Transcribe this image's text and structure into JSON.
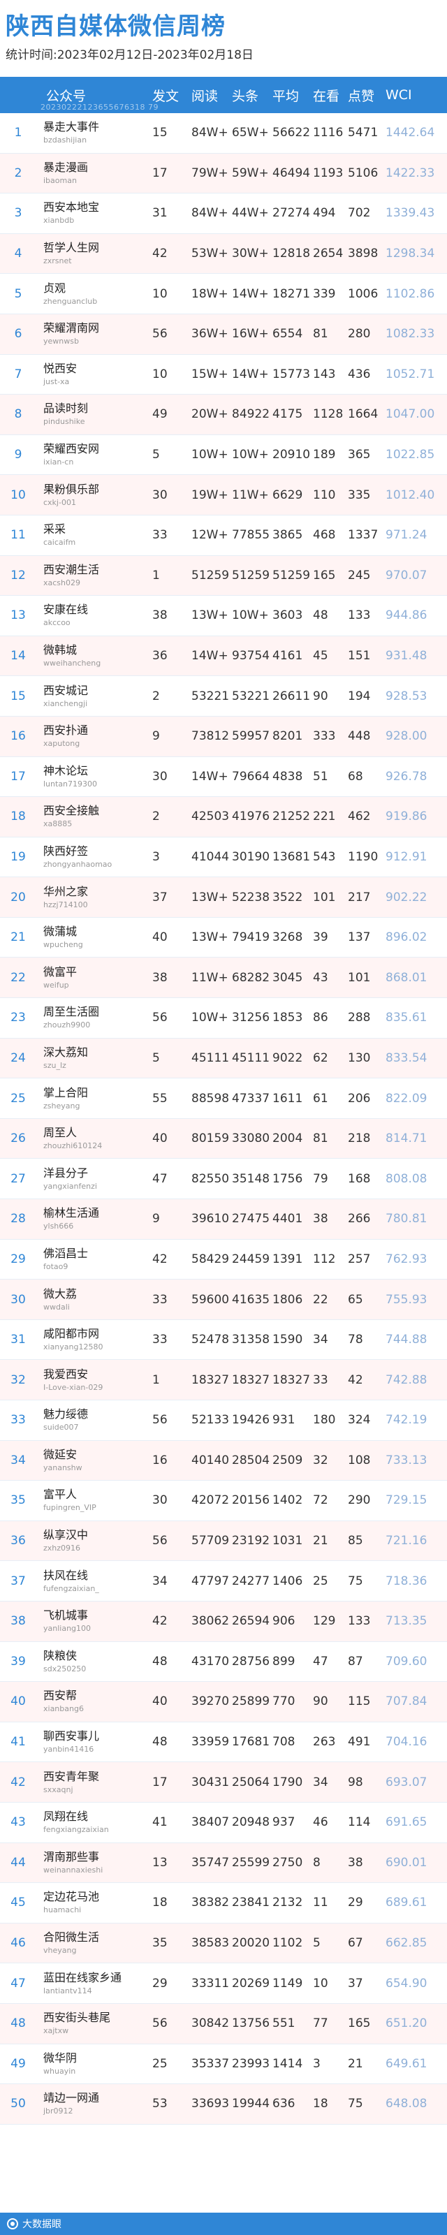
{
  "header": {
    "title": "陕西自媒体微信周榜",
    "subtitle": "统计时间:2023年02月12日-2023年02月18日"
  },
  "table": {
    "columns": {
      "account": "公众号",
      "posts": "发文",
      "reads": "阅读",
      "headline": "头条",
      "avg": "平均",
      "watching": "在看",
      "likes": "点赞",
      "wci": "WCI"
    },
    "watermark": "20230222123655676318 79",
    "rows": [
      {
        "rank": "1",
        "name": "暴走大事件",
        "id": "bzdashijian",
        "posts": "15",
        "reads": "84W+",
        "headline": "65W+",
        "avg": "56622",
        "watching": "1116",
        "likes": "5471",
        "wci": "1442.64"
      },
      {
        "rank": "2",
        "name": "暴走漫画",
        "id": "ibaoman",
        "posts": "17",
        "reads": "79W+",
        "headline": "59W+",
        "avg": "46494",
        "watching": "1193",
        "likes": "5106",
        "wci": "1422.33"
      },
      {
        "rank": "3",
        "name": "西安本地宝",
        "id": "xianbdb",
        "posts": "31",
        "reads": "84W+",
        "headline": "44W+",
        "avg": "27274",
        "watching": "494",
        "likes": "702",
        "wci": "1339.43"
      },
      {
        "rank": "4",
        "name": "哲学人生网",
        "id": "zxrsnet",
        "posts": "42",
        "reads": "53W+",
        "headline": "30W+",
        "avg": "12818",
        "watching": "2654",
        "likes": "3898",
        "wci": "1298.34"
      },
      {
        "rank": "5",
        "name": "贞观",
        "id": "zhenguanclub",
        "posts": "10",
        "reads": "18W+",
        "headline": "14W+",
        "avg": "18271",
        "watching": "339",
        "likes": "1006",
        "wci": "1102.86"
      },
      {
        "rank": "6",
        "name": "荣耀渭南网",
        "id": "yewnwsb",
        "posts": "56",
        "reads": "36W+",
        "headline": "16W+",
        "avg": "6554",
        "watching": "81",
        "likes": "280",
        "wci": "1082.33"
      },
      {
        "rank": "7",
        "name": "悦西安",
        "id": "just-xa",
        "posts": "10",
        "reads": "15W+",
        "headline": "14W+",
        "avg": "15773",
        "watching": "143",
        "likes": "436",
        "wci": "1052.71"
      },
      {
        "rank": "8",
        "name": "品读时刻",
        "id": "pindushike",
        "posts": "49",
        "reads": "20W+",
        "headline": "84922",
        "avg": "4175",
        "watching": "1128",
        "likes": "1664",
        "wci": "1047.00"
      },
      {
        "rank": "9",
        "name": "荣耀西安网",
        "id": "ixian-cn",
        "posts": "5",
        "reads": "10W+",
        "headline": "10W+",
        "avg": "20910",
        "watching": "189",
        "likes": "365",
        "wci": "1022.85"
      },
      {
        "rank": "10",
        "name": "果粉俱乐部",
        "id": "cxkj-001",
        "posts": "30",
        "reads": "19W+",
        "headline": "11W+",
        "avg": "6629",
        "watching": "110",
        "likes": "335",
        "wci": "1012.40"
      },
      {
        "rank": "11",
        "name": "采采",
        "id": "caicaifm",
        "posts": "33",
        "reads": "12W+",
        "headline": "77855",
        "avg": "3865",
        "watching": "468",
        "likes": "1337",
        "wci": "971.24"
      },
      {
        "rank": "12",
        "name": "西安潮生活",
        "id": "xacsh029",
        "posts": "1",
        "reads": "51259",
        "headline": "51259",
        "avg": "51259",
        "watching": "165",
        "likes": "245",
        "wci": "970.07"
      },
      {
        "rank": "13",
        "name": "安康在线",
        "id": "akccoo",
        "posts": "38",
        "reads": "13W+",
        "headline": "10W+",
        "avg": "3603",
        "watching": "48",
        "likes": "133",
        "wci": "944.86"
      },
      {
        "rank": "14",
        "name": "微韩城",
        "id": "wweihancheng",
        "posts": "36",
        "reads": "14W+",
        "headline": "93754",
        "avg": "4161",
        "watching": "45",
        "likes": "151",
        "wci": "931.48"
      },
      {
        "rank": "15",
        "name": "西安城记",
        "id": "xianchengji",
        "posts": "2",
        "reads": "53221",
        "headline": "53221",
        "avg": "26611",
        "watching": "90",
        "likes": "194",
        "wci": "928.53"
      },
      {
        "rank": "16",
        "name": "西安扑通",
        "id": "xaputong",
        "posts": "9",
        "reads": "73812",
        "headline": "59957",
        "avg": "8201",
        "watching": "333",
        "likes": "448",
        "wci": "928.00"
      },
      {
        "rank": "17",
        "name": "神木论坛",
        "id": "luntan719300",
        "posts": "30",
        "reads": "14W+",
        "headline": "79664",
        "avg": "4838",
        "watching": "51",
        "likes": "68",
        "wci": "926.78"
      },
      {
        "rank": "18",
        "name": "西安全接触",
        "id": "xa8885",
        "posts": "2",
        "reads": "42503",
        "headline": "41976",
        "avg": "21252",
        "watching": "221",
        "likes": "462",
        "wci": "919.86"
      },
      {
        "rank": "19",
        "name": "陕西好签",
        "id": "zhongyanhaomao",
        "posts": "3",
        "reads": "41044",
        "headline": "30190",
        "avg": "13681",
        "watching": "543",
        "likes": "1190",
        "wci": "912.91"
      },
      {
        "rank": "20",
        "name": "华州之家",
        "id": "hzzj714100",
        "posts": "37",
        "reads": "13W+",
        "headline": "52238",
        "avg": "3522",
        "watching": "101",
        "likes": "217",
        "wci": "902.22"
      },
      {
        "rank": "21",
        "name": "微蒲城",
        "id": "wpucheng",
        "posts": "40",
        "reads": "13W+",
        "headline": "79419",
        "avg": "3268",
        "watching": "39",
        "likes": "137",
        "wci": "896.02"
      },
      {
        "rank": "22",
        "name": "微富平",
        "id": "weifup",
        "posts": "38",
        "reads": "11W+",
        "headline": "68282",
        "avg": "3045",
        "watching": "43",
        "likes": "101",
        "wci": "868.01"
      },
      {
        "rank": "23",
        "name": "周至生活圈",
        "id": "zhouzh9900",
        "posts": "56",
        "reads": "10W+",
        "headline": "31256",
        "avg": "1853",
        "watching": "86",
        "likes": "288",
        "wci": "835.61"
      },
      {
        "rank": "24",
        "name": "深大荔知",
        "id": "szu_lz",
        "posts": "5",
        "reads": "45111",
        "headline": "45111",
        "avg": "9022",
        "watching": "62",
        "likes": "130",
        "wci": "833.54"
      },
      {
        "rank": "25",
        "name": "掌上合阳",
        "id": "zsheyang",
        "posts": "55",
        "reads": "88598",
        "headline": "47337",
        "avg": "1611",
        "watching": "61",
        "likes": "206",
        "wci": "822.09"
      },
      {
        "rank": "26",
        "name": "周至人",
        "id": "zhouzhi610124",
        "posts": "40",
        "reads": "80159",
        "headline": "33080",
        "avg": "2004",
        "watching": "81",
        "likes": "218",
        "wci": "814.71"
      },
      {
        "rank": "27",
        "name": "洋县分子",
        "id": "yangxianfenzi",
        "posts": "47",
        "reads": "82550",
        "headline": "35148",
        "avg": "1756",
        "watching": "79",
        "likes": "168",
        "wci": "808.08"
      },
      {
        "rank": "28",
        "name": "榆林生活通",
        "id": "ylsh666",
        "posts": "9",
        "reads": "39610",
        "headline": "27475",
        "avg": "4401",
        "watching": "38",
        "likes": "266",
        "wci": "780.81"
      },
      {
        "rank": "29",
        "name": "佛滔昌士",
        "id": "fotao9",
        "posts": "42",
        "reads": "58429",
        "headline": "24459",
        "avg": "1391",
        "watching": "112",
        "likes": "257",
        "wci": "762.93"
      },
      {
        "rank": "30",
        "name": "微大荔",
        "id": "wwdali",
        "posts": "33",
        "reads": "59600",
        "headline": "41635",
        "avg": "1806",
        "watching": "22",
        "likes": "65",
        "wci": "755.93"
      },
      {
        "rank": "31",
        "name": "咸阳都市网",
        "id": "xianyang12580",
        "posts": "33",
        "reads": "52478",
        "headline": "31358",
        "avg": "1590",
        "watching": "34",
        "likes": "78",
        "wci": "744.88"
      },
      {
        "rank": "32",
        "name": "我爱西安",
        "id": "I-Love-xian-029",
        "posts": "1",
        "reads": "18327",
        "headline": "18327",
        "avg": "18327",
        "watching": "33",
        "likes": "42",
        "wci": "742.88"
      },
      {
        "rank": "33",
        "name": "魅力绥德",
        "id": "suide007",
        "posts": "56",
        "reads": "52133",
        "headline": "19426",
        "avg": "931",
        "watching": "180",
        "likes": "324",
        "wci": "742.19"
      },
      {
        "rank": "34",
        "name": "微延安",
        "id": "yananshw",
        "posts": "16",
        "reads": "40140",
        "headline": "28504",
        "avg": "2509",
        "watching": "32",
        "likes": "108",
        "wci": "733.13"
      },
      {
        "rank": "35",
        "name": "富平人",
        "id": "fupingren_VIP",
        "posts": "30",
        "reads": "42072",
        "headline": "20156",
        "avg": "1402",
        "watching": "72",
        "likes": "290",
        "wci": "729.15"
      },
      {
        "rank": "36",
        "name": "纵享汉中",
        "id": "zxhz0916",
        "posts": "56",
        "reads": "57709",
        "headline": "23192",
        "avg": "1031",
        "watching": "21",
        "likes": "85",
        "wci": "721.16"
      },
      {
        "rank": "37",
        "name": "扶风在线",
        "id": "fufengzaixian_",
        "posts": "34",
        "reads": "47797",
        "headline": "24277",
        "avg": "1406",
        "watching": "25",
        "likes": "75",
        "wci": "718.36"
      },
      {
        "rank": "38",
        "name": "飞机城事",
        "id": "yanliang100",
        "posts": "42",
        "reads": "38062",
        "headline": "26594",
        "avg": "906",
        "watching": "129",
        "likes": "133",
        "wci": "713.35"
      },
      {
        "rank": "39",
        "name": "陕粮侠",
        "id": "sdx250250",
        "posts": "48",
        "reads": "43170",
        "headline": "28756",
        "avg": "899",
        "watching": "47",
        "likes": "87",
        "wci": "709.60"
      },
      {
        "rank": "40",
        "name": "西安帮",
        "id": "xianbang6",
        "posts": "40",
        "reads": "39270",
        "headline": "25899",
        "avg": "770",
        "watching": "90",
        "likes": "115",
        "wci": "707.84"
      },
      {
        "rank": "41",
        "name": "聊西安事儿",
        "id": "yanbin41416",
        "posts": "48",
        "reads": "33959",
        "headline": "17681",
        "avg": "708",
        "watching": "263",
        "likes": "491",
        "wci": "704.16"
      },
      {
        "rank": "42",
        "name": "西安青年聚",
        "id": "sxxaqnj",
        "posts": "17",
        "reads": "30431",
        "headline": "25064",
        "avg": "1790",
        "watching": "34",
        "likes": "98",
        "wci": "693.07"
      },
      {
        "rank": "43",
        "name": "凤翔在线",
        "id": "fengxiangzaixian",
        "posts": "41",
        "reads": "38407",
        "headline": "20948",
        "avg": "937",
        "watching": "46",
        "likes": "114",
        "wci": "691.65"
      },
      {
        "rank": "44",
        "name": "渭南那些事",
        "id": "weinannaxieshi",
        "posts": "13",
        "reads": "35747",
        "headline": "25599",
        "avg": "2750",
        "watching": "8",
        "likes": "38",
        "wci": "690.01"
      },
      {
        "rank": "45",
        "name": "定边花马池",
        "id": "huamachi",
        "posts": "18",
        "reads": "38382",
        "headline": "23841",
        "avg": "2132",
        "watching": "11",
        "likes": "29",
        "wci": "689.61"
      },
      {
        "rank": "46",
        "name": "合阳微生活",
        "id": "vheyang",
        "posts": "35",
        "reads": "38583",
        "headline": "20020",
        "avg": "1102",
        "watching": "5",
        "likes": "67",
        "wci": "662.85"
      },
      {
        "rank": "47",
        "name": "蓝田在线家乡通",
        "id": "lantiantv114",
        "posts": "29",
        "reads": "33311",
        "headline": "20269",
        "avg": "1149",
        "watching": "10",
        "likes": "37",
        "wci": "654.90"
      },
      {
        "rank": "48",
        "name": "西安街头巷尾",
        "id": "xajtxw",
        "posts": "56",
        "reads": "30842",
        "headline": "13756",
        "avg": "551",
        "watching": "77",
        "likes": "165",
        "wci": "651.20"
      },
      {
        "rank": "49",
        "name": "微华阴",
        "id": "whuayin",
        "posts": "25",
        "reads": "35337",
        "headline": "23993",
        "avg": "1414",
        "watching": "3",
        "likes": "21",
        "wci": "649.61"
      },
      {
        "rank": "50",
        "name": "靖边一网通",
        "id": "jbr0912",
        "posts": "53",
        "reads": "33693",
        "headline": "19944",
        "avg": "636",
        "watching": "18",
        "likes": "75",
        "wci": "648.08"
      }
    ]
  },
  "footer": {
    "text": "大数据眼"
  },
  "colors": {
    "accent": "#2f86d6",
    "row_alt": "#fff4f4",
    "wci_text": "#8fb0d8"
  }
}
